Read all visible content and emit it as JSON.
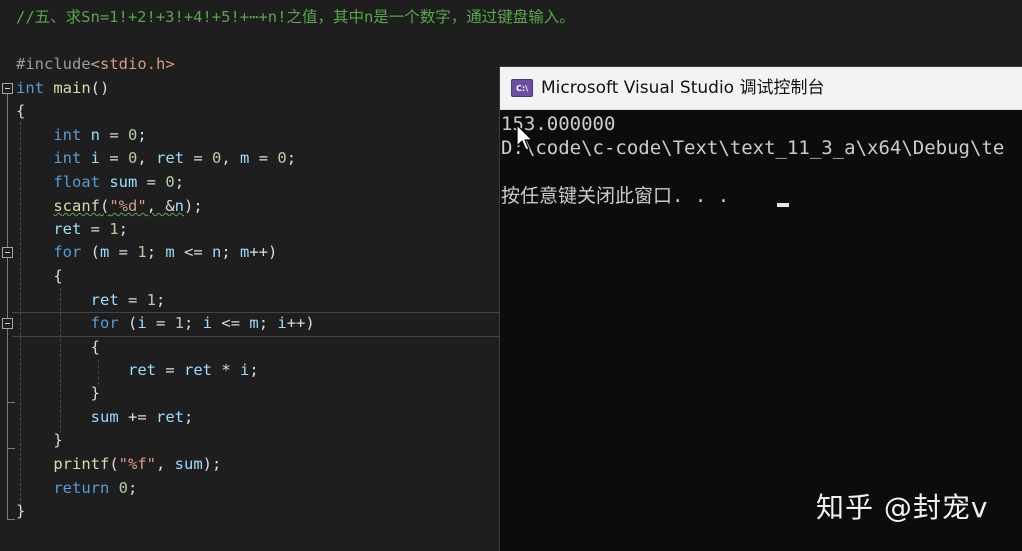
{
  "editor": {
    "comment": "//五、求Sn=1!+2!+3!+4!+5!+⋯+n!之值，其中n是一个数字，通过键盘输入。",
    "include_directive": "#include",
    "include_file": "<stdio.h>",
    "tokens": {
      "int": "int",
      "float": "float",
      "for": "for",
      "return": "return",
      "main": "main",
      "scanf": "scanf",
      "printf": "printf",
      "n": "n",
      "i": "i",
      "ret": "ret",
      "m": "m",
      "sum": "sum",
      "zero": "0",
      "one": "1",
      "fmt_d": "\"%d\"",
      "fmt_f": "\"%f\""
    }
  },
  "console": {
    "title": "Microsoft Visual Studio 调试控制台",
    "icon_text": "C:\\",
    "output_value": "153.000000",
    "output_path": "D:\\code\\c-code\\Text\\text_11_3_a\\x64\\Debug\\te",
    "press_key_message": "按任意键关闭此窗口. . ."
  },
  "watermark": "知乎 @封宠v",
  "colors": {
    "editor_background": "#1e1e1e",
    "console_background": "#0c0c0c",
    "keyword": "#569cd6",
    "comment": "#57a64a",
    "function": "#dcdcaa",
    "number": "#b5cea8"
  }
}
